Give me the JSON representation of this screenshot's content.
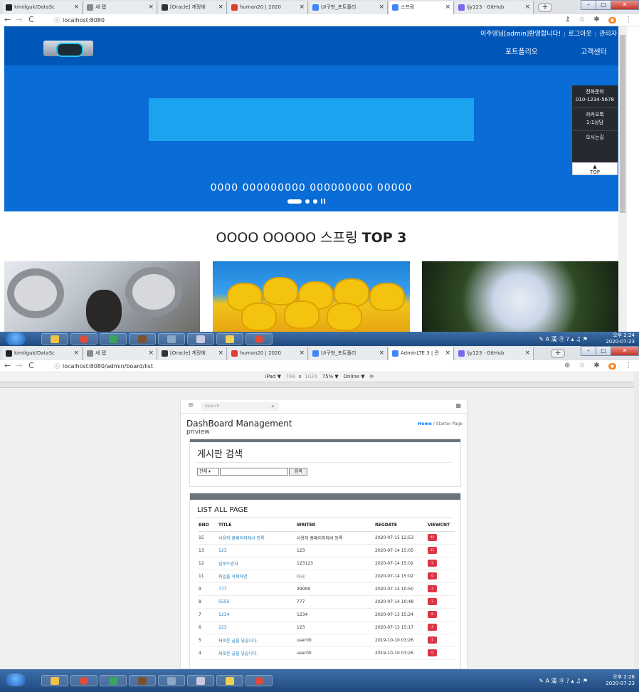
{
  "screen1": {
    "tabs": [
      {
        "title": "kimilguk/DataSc",
        "color": "#222222",
        "active": false
      },
      {
        "title": "새 탭",
        "color": "#888888",
        "active": false
      },
      {
        "title": "[Oracle] 계정에",
        "color": "#333333",
        "active": false
      },
      {
        "title": "human20 | 2020",
        "color": "#e03c31",
        "active": false
      },
      {
        "title": "UI구현_포트폴리",
        "color": "#4285f4",
        "active": false
      },
      {
        "title": "스프링",
        "color": "#4285f4",
        "active": true
      },
      {
        "title": "ljy123 · GitHub",
        "color": "#7b68ee",
        "active": false
      }
    ],
    "url": "localhost:8080",
    "site": {
      "user_greeting": "이주영님[admin]환영합니다!",
      "logout": "로그아웃",
      "admin": "관리자",
      "menu": [
        "포트폴리오",
        "고객센터"
      ],
      "hero_text": "0000 000000000 000000000 00000",
      "quick_menu": [
        "전화문의",
        "010-1234-5678",
        "카카오톡",
        "1:1상담",
        "오시는길"
      ],
      "top_button": "TOP",
      "section_title_pre": "OOOO OOOOO 스프링 ",
      "section_title_bold": "TOP 3"
    },
    "tray_time": "오후 2:24",
    "tray_date": "2020-07-23"
  },
  "screen2": {
    "tabs": [
      {
        "title": "kimilguk/DataSc",
        "color": "#222222",
        "active": false
      },
      {
        "title": "새 탭",
        "color": "#888888",
        "active": false
      },
      {
        "title": "[Oracle] 계정에",
        "color": "#333333",
        "active": false
      },
      {
        "title": "human20 | 2020",
        "color": "#e03c31",
        "active": false
      },
      {
        "title": "UI구현_포트폴리",
        "color": "#4285f4",
        "active": false
      },
      {
        "title": "AdminLTE 3 | 관",
        "color": "#4285f4",
        "active": true
      },
      {
        "title": "ljy123 · GitHub",
        "color": "#7b68ee",
        "active": false
      }
    ],
    "url": "localhost:8080/admin/board/list",
    "devtools": {
      "device": "iPad ▼",
      "width": "768",
      "times": "x",
      "height": "1024",
      "zoom": "75% ▼",
      "network": "Online ▼"
    },
    "admin": {
      "search_placeholder": "Search",
      "page_title": "DashBoard Management",
      "page_subtitle": "priview",
      "breadcrumb_home": "Home",
      "breadcrumb_sep": "/",
      "breadcrumb_current": "Starter Page",
      "search_card_title": "게시판 검색",
      "search_select": "전체 ▾",
      "search_button": "검색",
      "list_title": "LIST ALL PAGE",
      "columns": [
        "BNO",
        "TITLE",
        "WRITER",
        "REGDATE",
        "VIEWCNT"
      ],
      "rows": [
        {
          "bno": "15",
          "title": "사용자 홈페이지에서 등록",
          "writer": "사용자 홈페이지에서 등록",
          "regdate": "2020-07-15 12:53",
          "viewcnt": "45"
        },
        {
          "bno": "13",
          "title": "123",
          "writer": "123",
          "regdate": "2020-07-14 15:05",
          "viewcnt": "11"
        },
        {
          "bno": "12",
          "title": "업로드받지",
          "writer": "123123",
          "regdate": "2020-07-14 15:02",
          "viewcnt": "5"
        },
        {
          "bno": "11",
          "title": "파일을 삭제하면",
          "writer": "다시",
          "regdate": "2020-07-14 15:02",
          "viewcnt": "6"
        },
        {
          "bno": "9",
          "title": "777",
          "writer": "99999",
          "regdate": "2020-07-14 10:50",
          "viewcnt": "3"
        },
        {
          "bno": "8",
          "title": "5555",
          "writer": "777",
          "regdate": "2020-07-14 10:48",
          "viewcnt": "3"
        },
        {
          "bno": "7",
          "title": "1234",
          "writer": "1234",
          "regdate": "2020-07-13 15:24",
          "viewcnt": "8"
        },
        {
          "bno": "6",
          "title": "123",
          "writer": "123",
          "regdate": "2020-07-13 15:17",
          "viewcnt": "4"
        },
        {
          "bno": "5",
          "title": "새로운 글을 넣습니다.",
          "writer": "user00",
          "regdate": "2019-10-10 03:26",
          "viewcnt": "1"
        },
        {
          "bno": "4",
          "title": "새로운 글을 넣습니다.",
          "writer": "user00",
          "regdate": "2019-10-10 03:26",
          "viewcnt": "0"
        }
      ]
    },
    "tray_time": "오후 2:26",
    "tray_date": "2020-07-23"
  }
}
